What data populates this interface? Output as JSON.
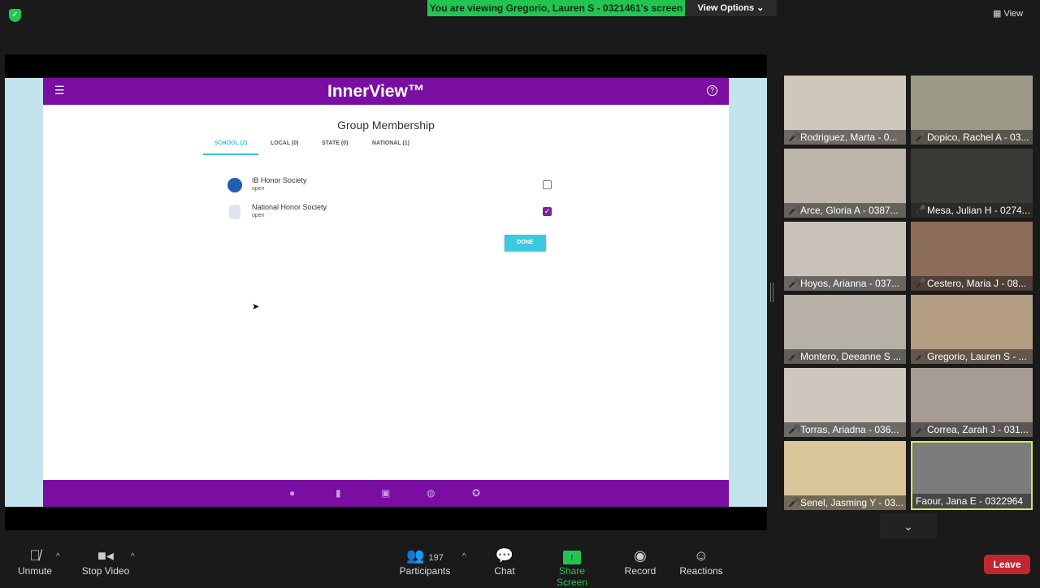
{
  "top": {
    "viewing_banner": "You are viewing Gregorio, Lauren S - 0321461's screen",
    "view_options": "View Options ⌄",
    "view": "View"
  },
  "app": {
    "brand": "InnerView™",
    "page_title": "Group Membership",
    "tabs": [
      {
        "label": "SCHOOL (2)"
      },
      {
        "label": "LOCAL (0)"
      },
      {
        "label": "STATE (0)"
      },
      {
        "label": "NATIONAL (1)"
      }
    ],
    "groups": [
      {
        "name": "IB Honor Society",
        "status": "open",
        "checked": false
      },
      {
        "name": "National Honor Society",
        "status": "open",
        "checked": true
      }
    ],
    "done": "DONE"
  },
  "participants": [
    "Rodriguez, Marta - 0...",
    "Dopico, Rachel A - 03...",
    "Arce, Gloria A - 0387...",
    "Mesa, Julian H - 0274...",
    "Hoyos, Arianna - 037...",
    "Cestero, Maria J - 08...",
    "Montero, Deeanne S ...",
    "Gregorio, Lauren S - ...",
    "Torras, Ariadna - 036...",
    "Correa, Zarah J - 031...",
    "Senel, Jasming Y - 03...",
    "Faour, Jana E - 0322964"
  ],
  "toolbar": {
    "unmute": "Unmute",
    "stop_video": "Stop Video",
    "participants": "Participants",
    "participant_count": "197",
    "chat": "Chat",
    "share_screen": "Share Screen",
    "record": "Record",
    "reactions": "Reactions",
    "leave": "Leave"
  }
}
